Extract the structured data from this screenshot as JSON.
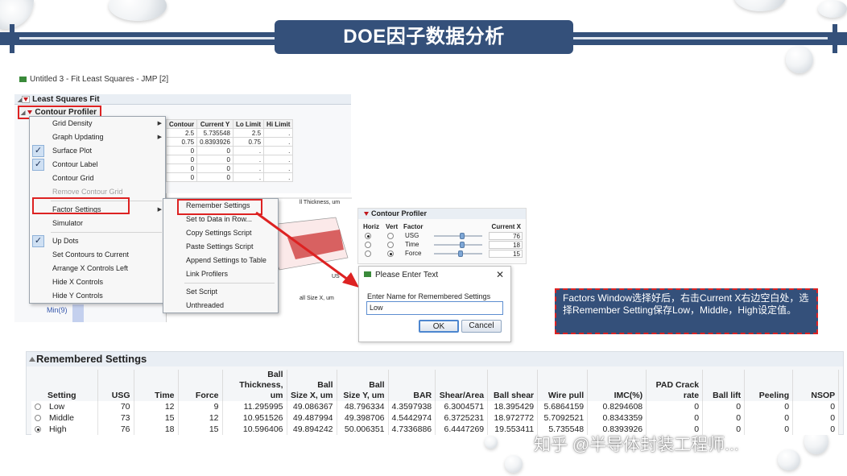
{
  "banner": {
    "title": "DOE因子数据分析"
  },
  "window": {
    "title": "Untitled 3 - Fit Least Squares - JMP [2]"
  },
  "report": {
    "section": "Least Squares Fit",
    "profiler": "Contour Profiler",
    "min_label": "Min(9)"
  },
  "grid": {
    "headers": [
      "Contour",
      "Current Y",
      "Lo Limit",
      "Hi Limit"
    ],
    "rows": [
      [
        "2.5",
        "5.735548",
        "2.5",
        "."
      ],
      [
        "0.75",
        "0.8393926",
        "0.75",
        "."
      ],
      [
        "0",
        "0",
        ".",
        "."
      ],
      [
        "0",
        "0",
        ".",
        "."
      ],
      [
        "0",
        "0",
        ".",
        "."
      ],
      [
        "0",
        "0",
        ".",
        "."
      ]
    ]
  },
  "menu1": {
    "items": [
      "Grid Density",
      "Graph Updating",
      "Surface Plot",
      "Contour Label",
      "Contour Grid",
      "Remove Contour Grid",
      "Factor Settings",
      "Simulator",
      "Up Dots",
      "Set Contours to Current",
      "Arrange X Controls Left",
      "Hide X Controls",
      "Hide Y Controls"
    ]
  },
  "menu2": {
    "items": [
      "Remember Settings",
      "Set to Data in Row...",
      "Copy Settings Script",
      "Paste Settings Script",
      "Append Settings to Table",
      "Link Profilers",
      "Set Script",
      "Unthreaded"
    ]
  },
  "plot_labels": {
    "a": "ll Thickness, um",
    "b": "US",
    "c": "all Size X, um"
  },
  "contour2": {
    "title": "Contour Profiler",
    "cols": {
      "horiz": "Horiz",
      "vert": "Vert",
      "factor": "Factor",
      "current": "Current X"
    },
    "rows": [
      {
        "factor": "USG",
        "value": "76",
        "knob": 0.6
      },
      {
        "factor": "Time",
        "value": "18",
        "knob": 0.6
      },
      {
        "factor": "Force",
        "value": "15",
        "knob": 0.55
      }
    ]
  },
  "dialog": {
    "title": "Please Enter Text",
    "label": "Enter Name for Remembered Settings",
    "value": "Low",
    "ok": "OK",
    "cancel": "Cancel"
  },
  "note": {
    "text": "Factors Window选择好后，右击Current X右边空白处，选择Remember Setting保存Low，Middle，High设定值。"
  },
  "remembered": {
    "title": "Remembered Settings",
    "headers": [
      [
        "",
        "Setting"
      ],
      [
        "",
        "USG"
      ],
      [
        "",
        "Time"
      ],
      [
        "",
        "Force"
      ],
      [
        "Ball",
        "Thickness, um"
      ],
      [
        "Ball",
        "Size X, um"
      ],
      [
        "Ball",
        "Size Y, um"
      ],
      [
        "",
        "BAR"
      ],
      [
        "",
        "Shear/Area"
      ],
      [
        "",
        "Ball shear"
      ],
      [
        "",
        "Wire pull"
      ],
      [
        "",
        "IMC(%)"
      ],
      [
        "PAD Crack",
        "rate"
      ],
      [
        "",
        "Ball lift"
      ],
      [
        "",
        "Peeling"
      ],
      [
        "",
        "NSOP"
      ]
    ],
    "rows": [
      [
        "Low",
        "70",
        "12",
        "9",
        "11.295995",
        "49.086367",
        "48.796334",
        "4.3597938",
        "6.3004571",
        "18.395429",
        "5.6864159",
        "0.8294608",
        "0",
        "0",
        "0",
        "0"
      ],
      [
        "Middle",
        "73",
        "15",
        "12",
        "10.951526",
        "49.487994",
        "49.398706",
        "4.5442974",
        "6.3725231",
        "18.972772",
        "5.7092521",
        "0.8343359",
        "0",
        "0",
        "0",
        "0"
      ],
      [
        "High",
        "76",
        "18",
        "15",
        "10.596406",
        "49.894242",
        "50.006351",
        "4.7336886",
        "6.4447269",
        "19.553411",
        "5.735548",
        "0.8393926",
        "0",
        "0",
        "0",
        "0"
      ]
    ],
    "selected": 2
  },
  "watermark": {
    "text": "知乎 @半导体封装工程师..."
  },
  "colors": {
    "banner": "#34507a",
    "highlight": "#dd2222",
    "arrow": "#dd2222"
  }
}
